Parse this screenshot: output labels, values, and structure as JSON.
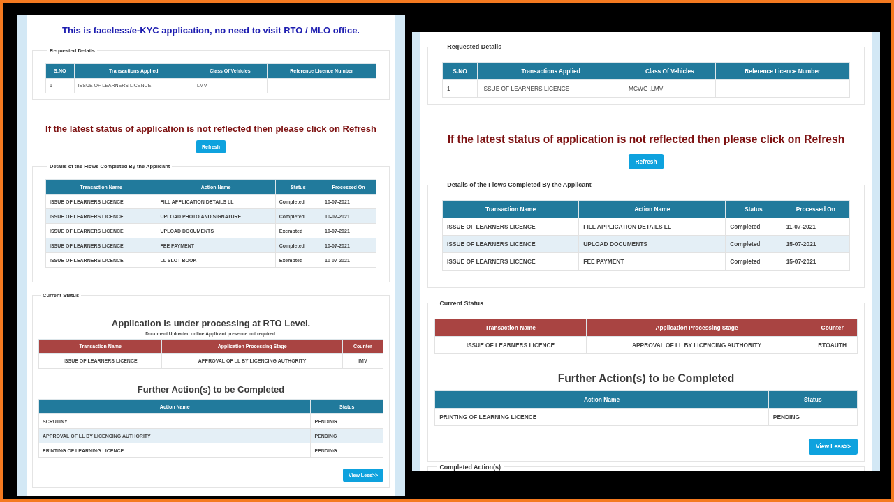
{
  "panels": [
    {
      "notice": "This is faceless/e-KYC application, no need to visit RTO / MLO office.",
      "requested_details": {
        "legend": "Requested Details",
        "columns": [
          "S.NO",
          "Transactions Applied",
          "Class Of Vehicles",
          "Reference Licence Number"
        ],
        "rows": [
          [
            "1",
            "ISSUE OF LEARNERS LICENCE",
            "LMV",
            "-"
          ]
        ]
      },
      "refresh_message": "If the latest status of application is not reflected then please click on Refresh",
      "refresh_button": "Refresh",
      "flows": {
        "legend": "Details of the Flows Completed By the Applicant",
        "columns": [
          "Transaction Name",
          "Action Name",
          "Status",
          "Processed On"
        ],
        "rows": [
          [
            "ISSUE OF LEARNERS LICENCE",
            "FILL APPLICATION DETAILS LL",
            "Completed",
            "10-07-2021"
          ],
          [
            "ISSUE OF LEARNERS LICENCE",
            "UPLOAD PHOTO AND SIGNATURE",
            "Completed",
            "10-07-2021"
          ],
          [
            "ISSUE OF LEARNERS LICENCE",
            "UPLOAD DOCUMENTS",
            "Exempted",
            "10-07-2021"
          ],
          [
            "ISSUE OF LEARNERS LICENCE",
            "FEE PAYMENT",
            "Completed",
            "10-07-2021"
          ],
          [
            "ISSUE OF LEARNERS LICENCE",
            "LL SLOT BOOK",
            "Exempted",
            "10-07-2021"
          ]
        ]
      },
      "current_status": {
        "legend": "Current Status",
        "heading": "Application is under processing at RTO Level.",
        "note": "Document Uploaded online.Applicant presence not required.",
        "columns": [
          "Transaction Name",
          "Application Processing Stage",
          "Counter"
        ],
        "rows": [
          [
            "ISSUE OF LEARNERS LICENCE",
            "APPROVAL OF LL BY LICENCING AUTHORITY",
            "IMV"
          ]
        ],
        "further_title": "Further Action(s) to be Completed",
        "further_columns": [
          "Action Name",
          "Status"
        ],
        "further_rows": [
          [
            "SCRUTINY",
            "PENDING"
          ],
          [
            "APPROVAL OF LL BY LICENCING AUTHORITY",
            "PENDING"
          ],
          [
            "PRINTING OF LEARNING LICENCE",
            "PENDING"
          ]
        ],
        "button": "View Less>>"
      }
    },
    {
      "requested_details": {
        "legend": "Requested Details",
        "columns": [
          "S.NO",
          "Transactions Applied",
          "Class Of Vehicles",
          "Reference Licence Number"
        ],
        "rows": [
          [
            "1",
            "ISSUE OF LEARNERS LICENCE",
            "MCWG ,LMV",
            "-"
          ]
        ]
      },
      "refresh_message": "If the latest status of application is not reflected then please click on Refresh",
      "refresh_button": "Refresh",
      "flows": {
        "legend": "Details of the Flows Completed By the Applicant",
        "columns": [
          "Transaction Name",
          "Action Name",
          "Status",
          "Processed On"
        ],
        "rows": [
          [
            "ISSUE OF LEARNERS LICENCE",
            "FILL APPLICATION DETAILS LL",
            "Completed",
            "11-07-2021"
          ],
          [
            "ISSUE OF LEARNERS LICENCE",
            "UPLOAD DOCUMENTS",
            "Completed",
            "15-07-2021"
          ],
          [
            "ISSUE OF LEARNERS LICENCE",
            "FEE PAYMENT",
            "Completed",
            "15-07-2021"
          ]
        ]
      },
      "current_status": {
        "legend": "Current Status",
        "columns": [
          "Transaction Name",
          "Application Processing Stage",
          "Counter"
        ],
        "rows": [
          [
            "ISSUE OF LEARNERS LICENCE",
            "APPROVAL OF LL BY LICENCING AUTHORITY",
            "RTOAUTH"
          ]
        ],
        "further_title": "Further Action(s) to be Completed",
        "further_columns": [
          "Action Name",
          "Status"
        ],
        "further_rows": [
          [
            "PRINTING OF LEARNING LICENCE",
            "PENDING"
          ]
        ],
        "button": "View Less>>"
      },
      "completed_legend": "Completed Action(s)"
    }
  ]
}
